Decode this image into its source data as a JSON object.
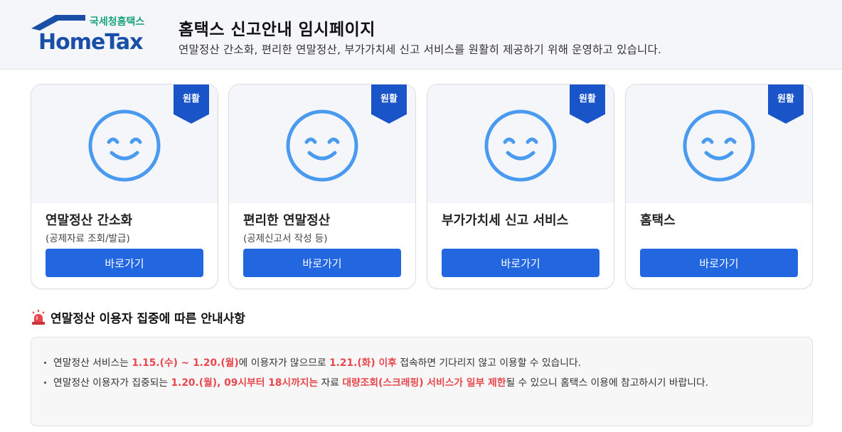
{
  "header": {
    "logo_small": "국세청홈택스",
    "logo_main": "HomeTax",
    "title": "홈택스 신고안내 임시페이지",
    "subtitle": "연말정산 간소화, 편리한 연말정산, 부가가치세 신고 서비스를 원활히 제공하기 위해 운영하고 있습니다."
  },
  "cards": [
    {
      "badge": "원활",
      "title": "연말정산 간소화",
      "sub": "(공제자료 조회/발급)",
      "button": "바로가기"
    },
    {
      "badge": "원활",
      "title": "편리한 연말정산",
      "sub": "(공제신고서 작성 등)",
      "button": "바로가기"
    },
    {
      "badge": "원활",
      "title": "부가가치세 신고 서비스",
      "sub": "",
      "button": "바로가기"
    },
    {
      "badge": "원활",
      "title": "홈택스",
      "sub": "",
      "button": "바로가기"
    }
  ],
  "notice": {
    "title": "연말정산 이용자 집중에 따른 안내사항",
    "item1": {
      "p1": "연말정산 서비스는 ",
      "h1": "1.15.(수) ~ 1.20.(월)",
      "p2": "에 이용자가 많으므로 ",
      "h2": "1.21.(화) 이후",
      "p3": " 접속하면 기다리지 않고 이용할 수 있습니다."
    },
    "item2": {
      "p1": "연말정산 이용자가 집중되는 ",
      "h1": "1.20.(월), 09시부터 18시까지는",
      "p2": " 자료 ",
      "h2": "대량조회(스크래핑) 서비스가 일부 제한",
      "p3": "될 수 있으니 홈택스 이용에 참고하시기 바랍니다."
    }
  },
  "colors": {
    "brand_blue": "#1a54c9",
    "button_blue": "#2266e0",
    "smiley_blue": "#4a9bf0",
    "highlight_red": "#e8474e",
    "logo_green": "#1aa37a"
  },
  "icons": {
    "logo": "hometax-house-logo",
    "card_image": "smiley-face-icon",
    "notice": "siren-icon"
  }
}
